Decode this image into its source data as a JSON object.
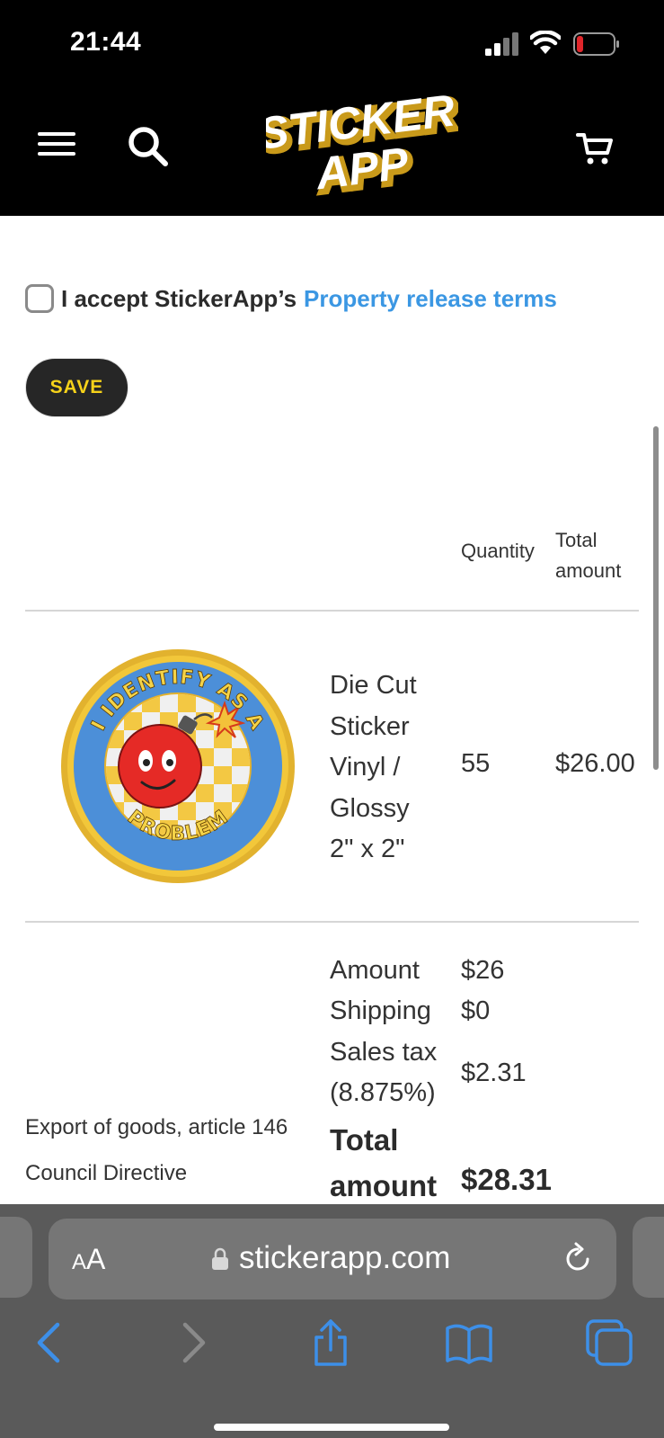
{
  "status_bar": {
    "time": "21:44"
  },
  "header": {
    "logo_line1": "STICKER",
    "logo_line2": "APP"
  },
  "terms": {
    "accept_text": "I accept StickerApp’s",
    "link_text": "Property release terms"
  },
  "save_label": "SAVE",
  "table": {
    "col_quantity": "Quantity",
    "col_total_line1": "Total",
    "col_total_line2": "amount",
    "item": {
      "name_lines": [
        "Die Cut",
        "Sticker",
        "Vinyl /",
        "Glossy",
        "2\" x 2\""
      ],
      "quantity": "55",
      "total": "$26.00",
      "patch_text_top": "I IDENTIFY AS A",
      "patch_text_bottom": "PROBLEM"
    }
  },
  "summary": {
    "amount_label": "Amount",
    "amount_value": "$26",
    "shipping_label": "Shipping",
    "shipping_value": "$0",
    "tax_label_line1": "Sales tax",
    "tax_label_line2": "(8.875%)",
    "tax_value": "$2.31",
    "export_note_line1": "Export of goods, article 146",
    "export_note_line2": "Council Directive",
    "total_label_line1": "Total",
    "total_label_line2": "amount",
    "total_value": "$28.31"
  },
  "browser": {
    "aa_label_small": "A",
    "aa_label_large": "A",
    "url": "stickerapp.com"
  },
  "colors": {
    "header_bg": "#000000",
    "link": "#3b97e3",
    "save_bg": "#262626",
    "save_text": "#f6d21a",
    "toolbar_icon": "#3d8fe8"
  }
}
